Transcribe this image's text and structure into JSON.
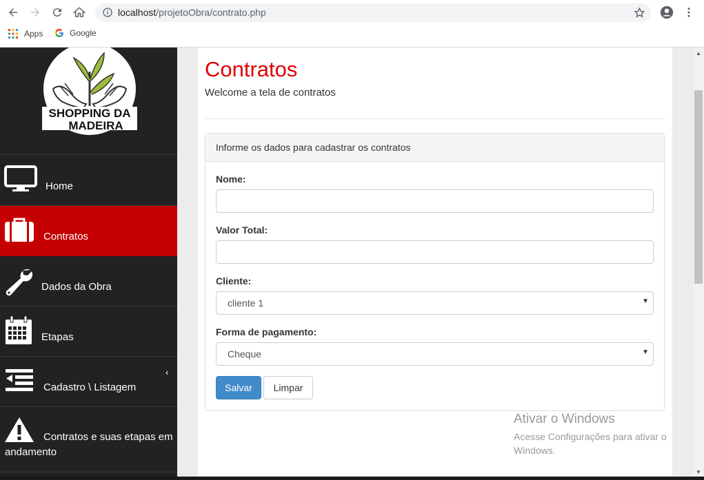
{
  "browser": {
    "url_host": "localhost",
    "url_path": "/projetoObra/contrato.php",
    "bookmarks": [
      {
        "label": "Apps",
        "icon": "apps-grid-icon"
      },
      {
        "label": "Google",
        "icon": "google-g-icon"
      }
    ]
  },
  "sidebar": {
    "logo_text_line1": "SHOPPING DA",
    "logo_text_line2": "MADEIRA",
    "items": [
      {
        "label": "Home",
        "icon": "monitor-icon"
      },
      {
        "label": "Contratos",
        "icon": "briefcase-icon",
        "active": true
      },
      {
        "label": "Dados da Obra",
        "icon": "wrench-icon"
      },
      {
        "label": "Etapas",
        "icon": "calendar-icon"
      },
      {
        "label": "Cadastro \\ Listagem",
        "icon": "list-indent-icon",
        "caret": "‹"
      },
      {
        "label": "Contratos e suas etapas em andamento",
        "icon": "warning-icon"
      }
    ]
  },
  "page": {
    "title": "Contratos",
    "subtitle": "Welcome a tela de contratos"
  },
  "form": {
    "heading": "Informe os dados para cadastrar os contratos",
    "nome_label": "Nome:",
    "nome_value": "",
    "valor_label": "Valor Total:",
    "valor_value": "",
    "cliente_label": "Cliente:",
    "cliente_selected": "cliente 1",
    "pagamento_label": "Forma de pagamento:",
    "pagamento_selected": "Cheque",
    "save_label": "Salvar",
    "clear_label": "Limpar"
  },
  "watermark": {
    "title": "Ativar o Windows",
    "text": "Acesse Configurações para ativar o Windows."
  },
  "colors": {
    "accent_red": "#e00000",
    "active_nav": "#c40000",
    "sidebar_bg": "#222222",
    "primary_button": "#428bca"
  }
}
